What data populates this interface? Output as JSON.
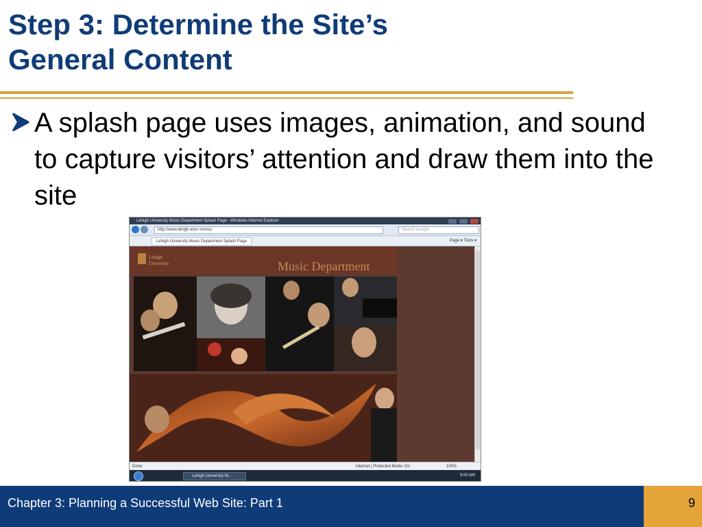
{
  "slide": {
    "title_line1": "Step 3: Determine the Site’s",
    "title_line2": "General Content",
    "bullet": "A splash page uses images, animation, and sound to capture visitors’ attention and draw them into the site",
    "footer": "Chapter 3: Planning a Successful Web Site: Part 1",
    "page_number": "9"
  },
  "screenshot": {
    "window_title": "Lehigh University Music Department Splash Page - Windows Internet Explorer",
    "url": "http://www.lehigh.edu/~inmsc/",
    "search_placeholder": "Search Google",
    "tab_label": "Lehigh University Music Department Splash Page",
    "toolbar_tools": "Page ▾  Tools ▾",
    "logo_line1": "Lehigh",
    "logo_line2": "University",
    "banner": "Music Department",
    "status_left": "Done",
    "status_middle": "Internet | Protected Mode: On",
    "zoom": "100%",
    "task_label": "Lehigh University M...",
    "clock": "9:00 AM"
  },
  "colors": {
    "title": "#0f3c78",
    "rule": "#d6a13a",
    "footer_bg": "#0f3c78",
    "page_bg": "#e5a43a",
    "music_banner": "#c48a55"
  },
  "icons": [
    "arrow-bullet-icon",
    "back-icon",
    "forward-icon",
    "start-icon",
    "internet-icon"
  ]
}
